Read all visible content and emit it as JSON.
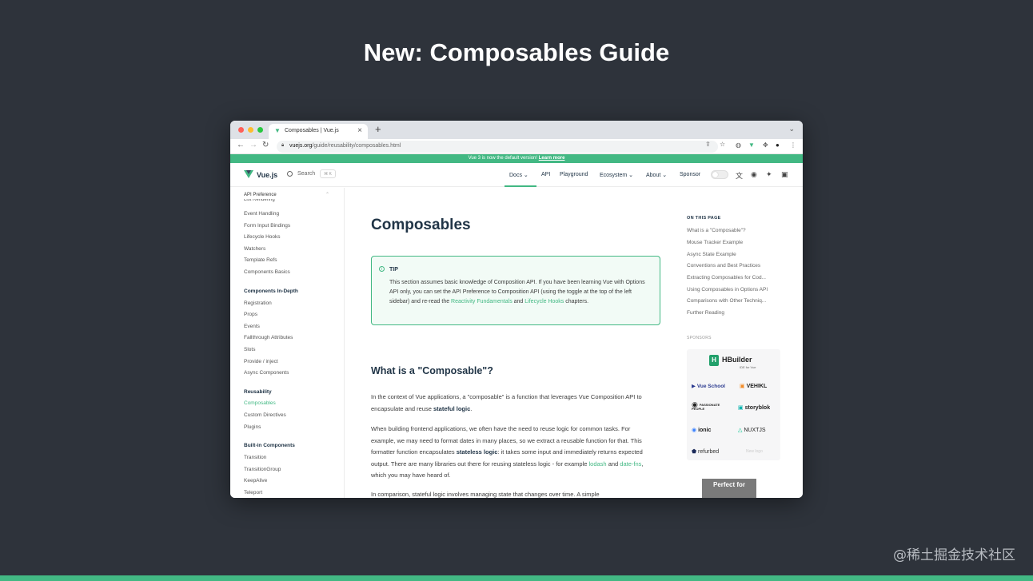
{
  "slide": {
    "title": "New: Composables Guide",
    "watermark": "@稀土掘金技术社区"
  },
  "browser": {
    "tab_title": "Composables | Vue.js",
    "url_host": "vuejs.org",
    "url_path": "/guide/reusability/composables.html"
  },
  "banner": {
    "text": "Vue 3 is now the default version!",
    "link": "Learn more"
  },
  "header": {
    "logo": "Vue.js",
    "search_label": "Search",
    "search_kbd": "⌘ K",
    "nav": [
      "Docs",
      "API",
      "Playground",
      "Ecosystem",
      "About",
      "Sponsor"
    ]
  },
  "sidebar": {
    "api_preference": "API Preference",
    "cut_item": "List Rendering",
    "items_top": [
      "Event Handling",
      "Form Input Bindings",
      "Lifecycle Hooks",
      "Watchers",
      "Template Refs",
      "Components Basics"
    ],
    "section_in_depth": "Components In-Depth",
    "items_in_depth": [
      "Registration",
      "Props",
      "Events",
      "Fallthrough Attributes",
      "Slots",
      "Provide / inject",
      "Async Components"
    ],
    "section_reusability": "Reusability",
    "items_reusability": [
      "Composables",
      "Custom Directives",
      "Plugins"
    ],
    "section_builtin": "Built-in Components",
    "items_builtin": [
      "Transition",
      "TransitionGroup",
      "KeepAlive",
      "Teleport"
    ]
  },
  "main": {
    "title": "Composables",
    "tip": {
      "label": "TIP",
      "text_1": "This section assumes basic knowledge of Composition API. If you have been learning Vue with Options API only, you can set the API Preference to Composition API (using the toggle at the top of the left sidebar) and re-read the ",
      "link_1": "Reactivity Fundamentals",
      "text_2": " and ",
      "link_2": "Lifecycle Hooks",
      "text_3": " chapters."
    },
    "h2": "What is a \"Composable\"?",
    "p1_a": "In the context of Vue applications, a \"composable\" is a function that leverages Vue Composition API to encapsulate and reuse ",
    "p1_b": "stateful logic",
    "p1_c": ".",
    "p2_a": "When building frontend applications, we often have the need to reuse logic for common tasks. For example, we may need to format dates in many places, so we extract a reusable function for that. This formatter function encapsulates ",
    "p2_b": "stateless logic",
    "p2_c": ": it takes some input and immediately returns expected output. There are many libraries out there for reusing stateless logic - for example ",
    "p2_link1": "lodash",
    "p2_and": " and ",
    "p2_link2": "date-fns",
    "p2_d": ", which you may have heard of.",
    "p3": "In comparison, stateful logic involves managing state that changes over time. A simple"
  },
  "aside": {
    "on_this_page": "ON THIS PAGE",
    "toc": [
      "What is a \"Composable\"?",
      "Mouse Tracker Example",
      "Async State Example",
      "Conventions and Best Practices",
      "Extracting Composables for Cod...",
      "Using Composables in Options API",
      "Comparisons with Other Techniq...",
      "Further Reading"
    ],
    "sponsors": "SPONSORS",
    "sponsor_names": {
      "hbuilder": "HBuilder",
      "hbuilder_sub": "IDE for Vue",
      "vueschool": "Vue School",
      "vehikl": "VEHIKL",
      "passionate": "PASSIONATE PEOPLE",
      "storyblok": "storyblok",
      "ionic": "ionic",
      "nuxtjs": "NUXTJS",
      "refurbed": "refurbed",
      "new_logo": "New logo"
    },
    "carbon": "Perfect for"
  }
}
